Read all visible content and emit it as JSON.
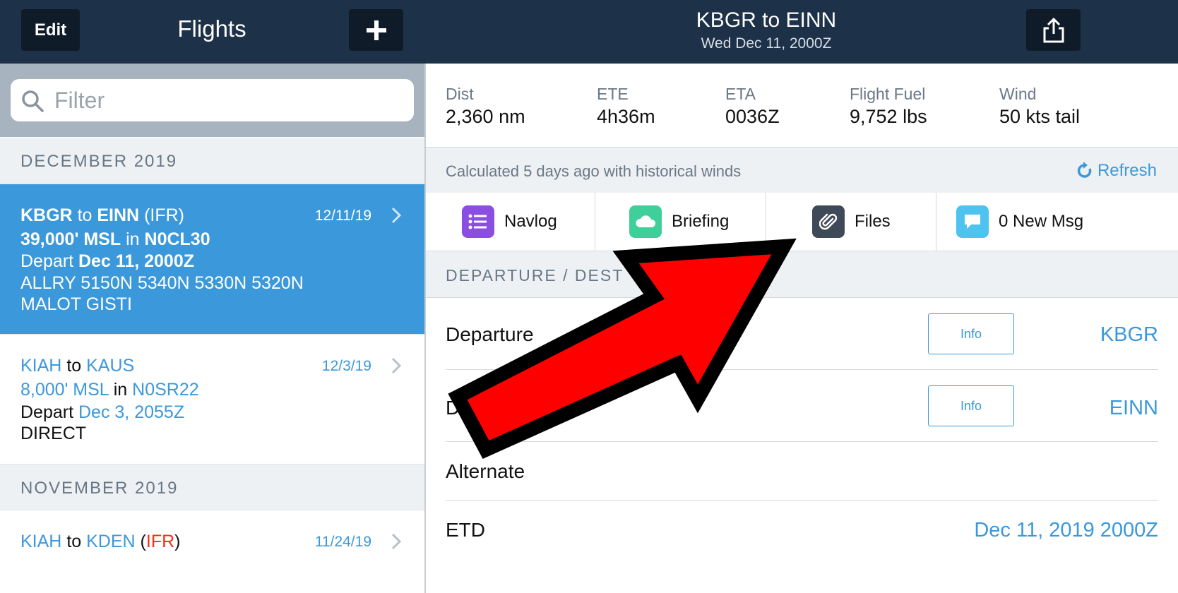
{
  "topbar": {
    "edit_label": "Edit",
    "flights_title": "Flights",
    "route_title": "KBGR to EINN",
    "route_subtitle": "Wed Dec 11, 2000Z"
  },
  "filter": {
    "placeholder": "Filter"
  },
  "sections": [
    {
      "label": "DECEMBER 2019"
    },
    {
      "label": "NOVEMBER 2019"
    }
  ],
  "flights": [
    {
      "from": "KBGR",
      "to_word": "to",
      "to": "EINN",
      "rules": "(IFR)",
      "date": "12/11/19",
      "altitude": "39,000' MSL",
      "in_word": "in",
      "aircraft": "N0CL30",
      "depart_word": "Depart",
      "depart_time": "Dec 11, 2000Z",
      "route1": "ALLRY 5150N 5340N 5330N 5320N",
      "route2": "MALOT GISTI"
    },
    {
      "from": "KIAH",
      "to_word": "to",
      "to": "KAUS",
      "date": "12/3/19",
      "altitude": "8,000' MSL",
      "in_word": "in",
      "aircraft": "N0SR22",
      "depart_word": "Depart",
      "depart_time": "Dec 3, 2055Z",
      "route1": "DIRECT"
    },
    {
      "from": "KIAH",
      "to_word": "to",
      "to": "KDEN",
      "rules_open": "(",
      "rules": "IFR",
      "rules_close": ")",
      "date": "11/24/19"
    }
  ],
  "stats": [
    {
      "label": "Dist",
      "value": "2,360 nm"
    },
    {
      "label": "ETE",
      "value": "4h36m"
    },
    {
      "label": "ETA",
      "value": "0036Z"
    },
    {
      "label": "Flight Fuel",
      "value": "9,752 lbs"
    },
    {
      "label": "Wind",
      "value": "50 kts tail"
    }
  ],
  "calc": {
    "text": "Calculated 5 days ago with historical winds",
    "refresh_label": "Refresh"
  },
  "tabs": [
    {
      "label": "Navlog",
      "icon": "list-icon",
      "color": "#8a4fe0"
    },
    {
      "label": "Briefing",
      "icon": "cloud-icon",
      "color": "#3ecf9a"
    },
    {
      "label": "Files",
      "icon": "paperclip-icon",
      "color": "#3e4a58"
    },
    {
      "label": "0 New Msg",
      "icon": "message-icon",
      "color": "#4ec3f0"
    }
  ],
  "dep_section": {
    "label": "DEPARTURE / DEST"
  },
  "rows": [
    {
      "label": "Departure",
      "info_label": "Info",
      "value": "KBGR"
    },
    {
      "label": "D",
      "info_label": "Info",
      "value": "EINN"
    },
    {
      "label": "Alternate",
      "value": ""
    },
    {
      "label": "ETD",
      "value": "Dec 11, 2019 2000Z"
    }
  ],
  "colors": {
    "accent": "#3b98da",
    "topbar": "#1d3148",
    "selected": "#3b98da",
    "ifr_red": "#ff2a17",
    "arrow": "#ff0000"
  }
}
